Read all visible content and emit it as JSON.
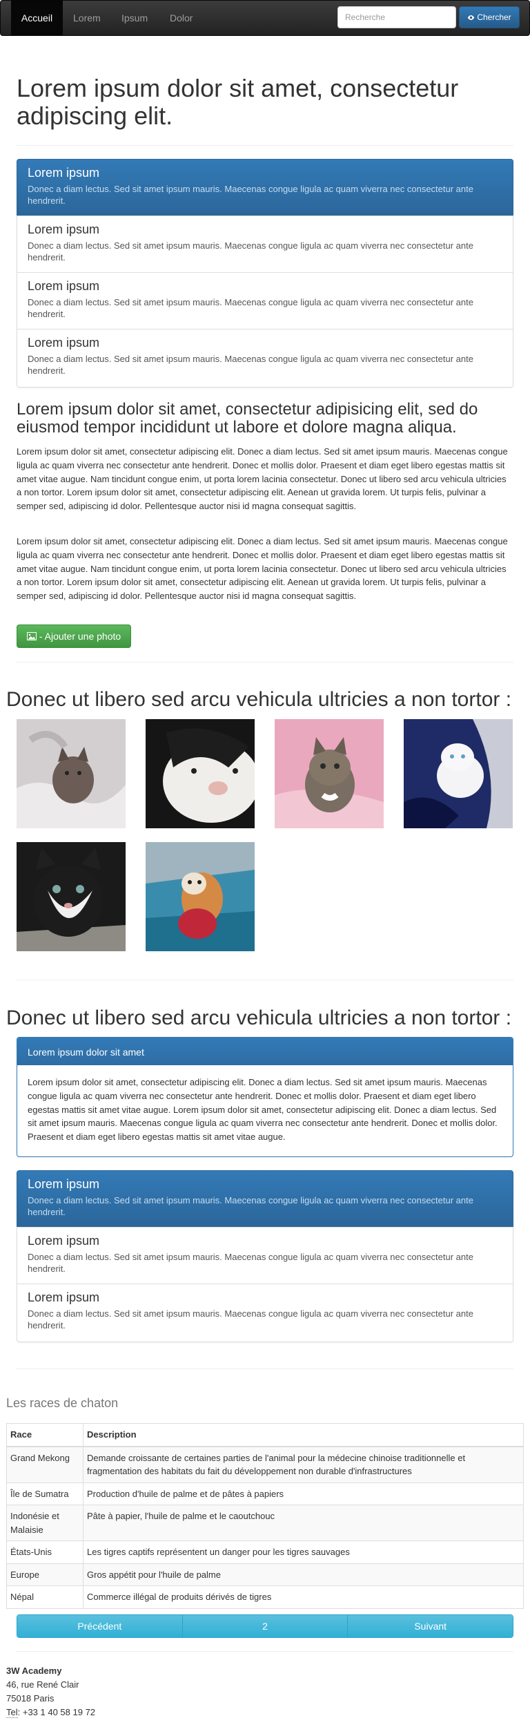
{
  "navbar": {
    "items": [
      {
        "label": "Accueil",
        "active": true
      },
      {
        "label": "Lorem",
        "active": false
      },
      {
        "label": "Ipsum",
        "active": false
      },
      {
        "label": "Dolor",
        "active": false
      }
    ],
    "search_placeholder": "Recherche",
    "search_button": "Chercher"
  },
  "main_title": "Lorem ipsum dolor sit amet, consectetur adipiscing elit.",
  "list_group_1": [
    {
      "heading": "Lorem ipsum",
      "text": "Donec a diam lectus. Sed sit amet ipsum mauris. Maecenas congue ligula ac quam viverra nec consectetur ante hendrerit.",
      "active": true
    },
    {
      "heading": "Lorem ipsum",
      "text": "Donec a diam lectus. Sed sit amet ipsum mauris. Maecenas congue ligula ac quam viverra nec consectetur ante hendrerit.",
      "active": false
    },
    {
      "heading": "Lorem ipsum",
      "text": "Donec a diam lectus. Sed sit amet ipsum mauris. Maecenas congue ligula ac quam viverra nec consectetur ante hendrerit.",
      "active": false
    },
    {
      "heading": "Lorem ipsum",
      "text": "Donec a diam lectus. Sed sit amet ipsum mauris. Maecenas congue ligula ac quam viverra nec consectetur ante hendrerit.",
      "active": false
    }
  ],
  "subtitle": "Lorem ipsum dolor sit amet, consectetur adipisicing elit, sed do eiusmod tempor incididunt ut labore et dolore magna aliqua.",
  "paragraph_1": "Lorem ipsum dolor sit amet, consectetur adipiscing elit. Donec a diam lectus. Sed sit amet ipsum mauris. Maecenas congue ligula ac quam viverra nec consectetur ante hendrerit. Donec et mollis dolor. Praesent et diam eget libero egestas mattis sit amet vitae augue. Nam tincidunt congue enim, ut porta lorem lacinia consectetur. Donec ut libero sed arcu vehicula ultricies a non tortor. Lorem ipsum dolor sit amet, consectetur adipiscing elit. Aenean ut gravida lorem. Ut turpis felis, pulvinar a semper sed, adipiscing id dolor. Pellentesque auctor nisi id magna consequat sagittis.",
  "paragraph_2": "Lorem ipsum dolor sit amet, consectetur adipiscing elit. Donec a diam lectus. Sed sit amet ipsum mauris. Maecenas congue ligula ac quam viverra nec consectetur ante hendrerit. Donec et mollis dolor. Praesent et diam eget libero egestas mattis sit amet vitae augue. Nam tincidunt congue enim, ut porta lorem lacinia consectetur. Donec ut libero sed arcu vehicula ultricies a non tortor. Lorem ipsum dolor sit amet, consectetur adipiscing elit. Aenean ut gravida lorem. Ut turpis felis, pulvinar a semper sed, adipiscing id dolor. Pellentesque auctor nisi id magna consequat sagittis.",
  "add_photo_button": "- Ajouter une photo",
  "gallery_title": "Donec ut libero sed arcu vehicula ultricies a non tortor :",
  "gallery": [
    {
      "name": "kitten-photo-1",
      "bg": "#c9c4c6",
      "fg": "#6b5d55"
    },
    {
      "name": "kitten-photo-2",
      "bg": "#1b1b1b",
      "fg": "#f1efec"
    },
    {
      "name": "kitten-photo-3",
      "bg": "#e6a4bb",
      "fg": "#6f655b"
    },
    {
      "name": "kitten-photo-4",
      "bg": "#26326f",
      "fg": "#f3f3f6"
    },
    {
      "name": "kitten-photo-5",
      "bg": "#1a1a1a",
      "fg": "#f0f0ee"
    },
    {
      "name": "kitten-photo-6",
      "bg": "#3c8fb0",
      "fg": "#d58a45"
    }
  ],
  "section2_title": "Donec ut libero sed arcu vehicula ultricies a non tortor :",
  "panel": {
    "heading": "Lorem ipsum dolor sit amet",
    "body": "Lorem ipsum dolor sit amet, consectetur adipiscing elit. Donec a diam lectus. Sed sit amet ipsum mauris. Maecenas congue ligula ac quam viverra nec consectetur ante hendrerit. Donec et mollis dolor. Praesent et diam eget libero egestas mattis sit amet vitae augue. Lorem ipsum dolor sit amet, consectetur adipiscing elit. Donec a diam lectus. Sed sit amet ipsum mauris. Maecenas congue ligula ac quam viverra nec consectetur ante hendrerit. Donec et mollis dolor. Praesent et diam eget libero egestas mattis sit amet vitae augue."
  },
  "list_group_2": [
    {
      "heading": "Lorem ipsum",
      "text": "Donec a diam lectus. Sed sit amet ipsum mauris. Maecenas congue ligula ac quam viverra nec consectetur ante hendrerit.",
      "active": true
    },
    {
      "heading": "Lorem ipsum",
      "text": "Donec a diam lectus. Sed sit amet ipsum mauris. Maecenas congue ligula ac quam viverra nec consectetur ante hendrerit.",
      "active": false
    },
    {
      "heading": "Lorem ipsum",
      "text": "Donec a diam lectus. Sed sit amet ipsum mauris. Maecenas congue ligula ac quam viverra nec consectetur ante hendrerit.",
      "active": false
    }
  ],
  "table": {
    "title": "Les races de chaton",
    "headers": [
      "Race",
      "Description"
    ],
    "rows": [
      [
        "Grand Mekong",
        "Demande croissante de certaines parties de l'animal pour la médecine chinoise traditionnelle et fragmentation des habitats du fait du développement non durable d'infrastructures"
      ],
      [
        "Île de Sumatra",
        "Production d'huile de palme et de pâtes à papiers"
      ],
      [
        "Indonésie et Malaisie",
        "Pâte à papier, l'huile de palme et le caoutchouc"
      ],
      [
        "États-Unis",
        "Les tigres captifs représentent un danger pour les tigres sauvages"
      ],
      [
        "Europe",
        "Gros appétit pour l'huile de palme"
      ],
      [
        "Népal",
        "Commerce illégal de produits dérivés de tigres"
      ]
    ]
  },
  "pagination": {
    "prev": "Précédent",
    "page": "2",
    "next": "Suivant"
  },
  "footer": {
    "name": "3W Academy",
    "street": "46, rue René Clair",
    "city": "75018 Paris",
    "tel_label": "Tel",
    "tel": ": +33 1 40 58 19 72"
  },
  "colors": {
    "primary": "#337ab7",
    "success": "#5cb85c",
    "info": "#5bc0de",
    "navbar": "#222222"
  }
}
